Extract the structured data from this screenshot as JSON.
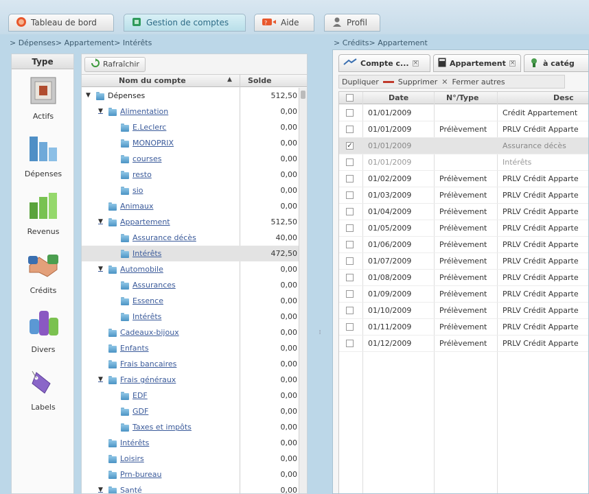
{
  "top_tabs": [
    {
      "label": "Tableau de bord",
      "icon": "dashboard-icon"
    },
    {
      "label": "Gestion de comptes",
      "icon": "accounts-icon",
      "active": true
    },
    {
      "label": "Aide",
      "icon": "help-icon"
    },
    {
      "label": "Profil",
      "icon": "profile-icon"
    }
  ],
  "left_breadcrumb": "> Dépenses> Appartement> Intérêts",
  "right_breadcrumb": "> Crédits> Appartement",
  "type_panel": {
    "header": "Type",
    "items": [
      "Actifs",
      "Dépenses",
      "Revenus",
      "Crédits",
      "Divers",
      "Labels"
    ]
  },
  "tree": {
    "refresh_label": "Rafraîchir",
    "col_name": "Nom du compte",
    "col_sort": "▲",
    "col_balance": "Solde",
    "rows": [
      {
        "label": "Dépenses",
        "amount": "512,50",
        "level": 0,
        "expanded": true,
        "plain": true
      },
      {
        "label": "Alimentation",
        "amount": "0,00",
        "level": 1,
        "expanded": true
      },
      {
        "label": "E.Leclerc",
        "amount": "0,00",
        "level": 2
      },
      {
        "label": "MONOPRIX",
        "amount": "0,00",
        "level": 2
      },
      {
        "label": "courses",
        "amount": "0,00",
        "level": 2
      },
      {
        "label": "resto",
        "amount": "0,00",
        "level": 2
      },
      {
        "label": "sio",
        "amount": "0,00",
        "level": 2
      },
      {
        "label": "Animaux",
        "amount": "0,00",
        "level": 1
      },
      {
        "label": "Appartement",
        "amount": "512,50",
        "level": 1,
        "expanded": true
      },
      {
        "label": "Assurance décès",
        "amount": "40,00",
        "level": 2
      },
      {
        "label": "Intérêts",
        "amount": "472,50",
        "level": 2,
        "selected": true
      },
      {
        "label": "Automobile",
        "amount": "0,00",
        "level": 1,
        "expanded": true
      },
      {
        "label": "Assurances",
        "amount": "0,00",
        "level": 2
      },
      {
        "label": "Essence",
        "amount": "0,00",
        "level": 2
      },
      {
        "label": "Intérêts",
        "amount": "0,00",
        "level": 2
      },
      {
        "label": "Cadeaux-bijoux",
        "amount": "0,00",
        "level": 1
      },
      {
        "label": "Enfants",
        "amount": "0,00",
        "level": 1
      },
      {
        "label": "Frais bancaires",
        "amount": "0,00",
        "level": 1
      },
      {
        "label": "Frais généraux",
        "amount": "0,00",
        "level": 1,
        "expanded": true
      },
      {
        "label": "EDF",
        "amount": "0,00",
        "level": 2
      },
      {
        "label": "GDF",
        "amount": "0,00",
        "level": 2
      },
      {
        "label": "Taxes et impôts",
        "amount": "0,00",
        "level": 2
      },
      {
        "label": "Intérêts",
        "amount": "0,00",
        "level": 1
      },
      {
        "label": "Loisirs",
        "amount": "0,00",
        "level": 1
      },
      {
        "label": "Prn-bureau",
        "amount": "0,00",
        "level": 1
      },
      {
        "label": "Santé",
        "amount": "0,00",
        "level": 1,
        "expanded": true
      }
    ]
  },
  "right": {
    "tabs": [
      {
        "label": "Compte c...",
        "icon": "account-tab-icon"
      },
      {
        "label": "Appartement",
        "icon": "calculator-icon"
      },
      {
        "label": "à catég",
        "icon": "category-icon"
      }
    ],
    "toolbar": {
      "duplicate": "Dupliquer",
      "delete": "Supprimer",
      "close_others": "Fermer autres"
    },
    "columns": [
      "Date",
      "N°/Type",
      "Desc"
    ],
    "rows": [
      {
        "date": "01/01/2009",
        "type": "",
        "desc": "Crédit Appartement",
        "checked": false
      },
      {
        "date": "01/01/2009",
        "type": "Prélèvement",
        "desc": "PRLV Crédit Apparte",
        "checked": false
      },
      {
        "date": "01/01/2009",
        "type": "",
        "desc": "Assurance décès",
        "checked": true,
        "selected": true
      },
      {
        "date": "01/01/2009",
        "type": "",
        "desc": "Intérêts",
        "checked": false,
        "dim": true
      },
      {
        "date": "01/02/2009",
        "type": "Prélèvement",
        "desc": "PRLV Crédit Apparte",
        "checked": false
      },
      {
        "date": "01/03/2009",
        "type": "Prélèvement",
        "desc": "PRLV Crédit Apparte",
        "checked": false
      },
      {
        "date": "01/04/2009",
        "type": "Prélèvement",
        "desc": "PRLV Crédit Apparte",
        "checked": false
      },
      {
        "date": "01/05/2009",
        "type": "Prélèvement",
        "desc": "PRLV Crédit Apparte",
        "checked": false
      },
      {
        "date": "01/06/2009",
        "type": "Prélèvement",
        "desc": "PRLV Crédit Apparte",
        "checked": false
      },
      {
        "date": "01/07/2009",
        "type": "Prélèvement",
        "desc": "PRLV Crédit Apparte",
        "checked": false
      },
      {
        "date": "01/08/2009",
        "type": "Prélèvement",
        "desc": "PRLV Crédit Apparte",
        "checked": false
      },
      {
        "date": "01/09/2009",
        "type": "Prélèvement",
        "desc": "PRLV Crédit Apparte",
        "checked": false
      },
      {
        "date": "01/10/2009",
        "type": "Prélèvement",
        "desc": "PRLV Crédit Apparte",
        "checked": false
      },
      {
        "date": "01/11/2009",
        "type": "Prélèvement",
        "desc": "PRLV Crédit Apparte",
        "checked": false
      },
      {
        "date": "01/12/2009",
        "type": "Prélèvement",
        "desc": "PRLV Crédit Apparte",
        "checked": false
      }
    ]
  },
  "colors": {
    "accent": "#2d6b86",
    "link": "#3a5a9a"
  }
}
